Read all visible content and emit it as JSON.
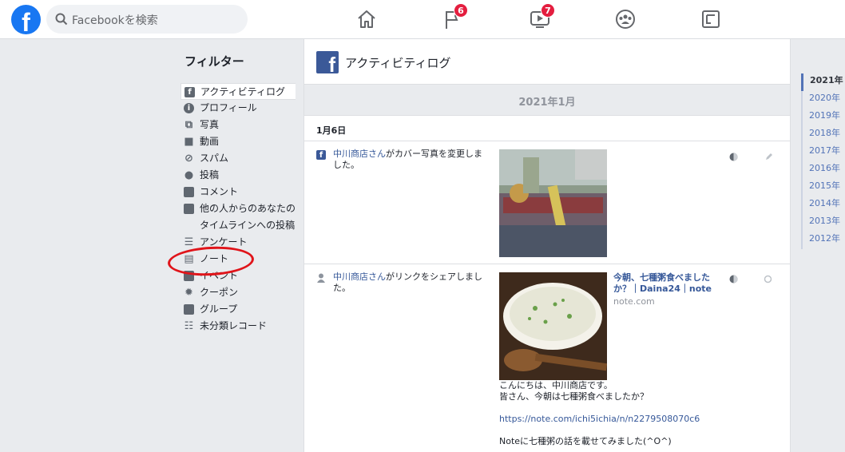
{
  "topbar": {
    "logo": "f",
    "search_placeholder": "Facebookを検索",
    "notifications": {
      "flag_badge": "6",
      "video_badge": "7"
    }
  },
  "sidebar": {
    "title": "フィルター",
    "items": [
      {
        "label": "アクティビティログ",
        "icon": "f"
      },
      {
        "label": "プロフィール",
        "icon": "i"
      },
      {
        "label": "写真",
        "icon": "photo-icon"
      },
      {
        "label": "動画",
        "icon": "video-icon"
      },
      {
        "label": "スパム",
        "icon": "block-icon"
      },
      {
        "label": "投稿",
        "icon": "person-icon"
      },
      {
        "label": "コメント",
        "icon": "comment-icon"
      },
      {
        "label": "他の人からのあなたのタイムラインへの投稿",
        "icon": "comment-icon"
      },
      {
        "label": "アンケート",
        "icon": "poll-icon"
      },
      {
        "label": "ノート",
        "icon": "note-icon"
      },
      {
        "label": "イベント",
        "icon": "calendar-icon"
      },
      {
        "label": "クーポン",
        "icon": "gear-icon"
      },
      {
        "label": "グループ",
        "icon": "group-icon"
      },
      {
        "label": "未分類レコード",
        "icon": "list-icon"
      }
    ]
  },
  "main": {
    "title": "アクティビティログ",
    "month": "2021年1月",
    "day": "1月6日",
    "entries": [
      {
        "actor": "中川商店さん",
        "text": "がカバー写真を変更しました。"
      },
      {
        "actor": "中川商店さん",
        "text": "がリンクをシェアしました。",
        "link_title": "今朝、七種粥食べましたか？｜Daina24｜note",
        "link_domain": "note.com",
        "body_line1": "こんにちは、中川商店です。",
        "body_line2": "皆さん、今朝は七種粥食べましたか？",
        "url": "https://note.com/ichi5ichia/n/n2279508070c6",
        "body_line3": "Noteに七種粥の話を載せてみました(^O^)"
      }
    ]
  },
  "years": [
    "2021年",
    "2020年",
    "2019年",
    "2018年",
    "2017年",
    "2016年",
    "2015年",
    "2014年",
    "2013年",
    "2012年"
  ],
  "colors": {
    "brand": "#1877f2",
    "link": "#365899",
    "badge": "#e41e3f",
    "annotation": "#e0141a"
  }
}
